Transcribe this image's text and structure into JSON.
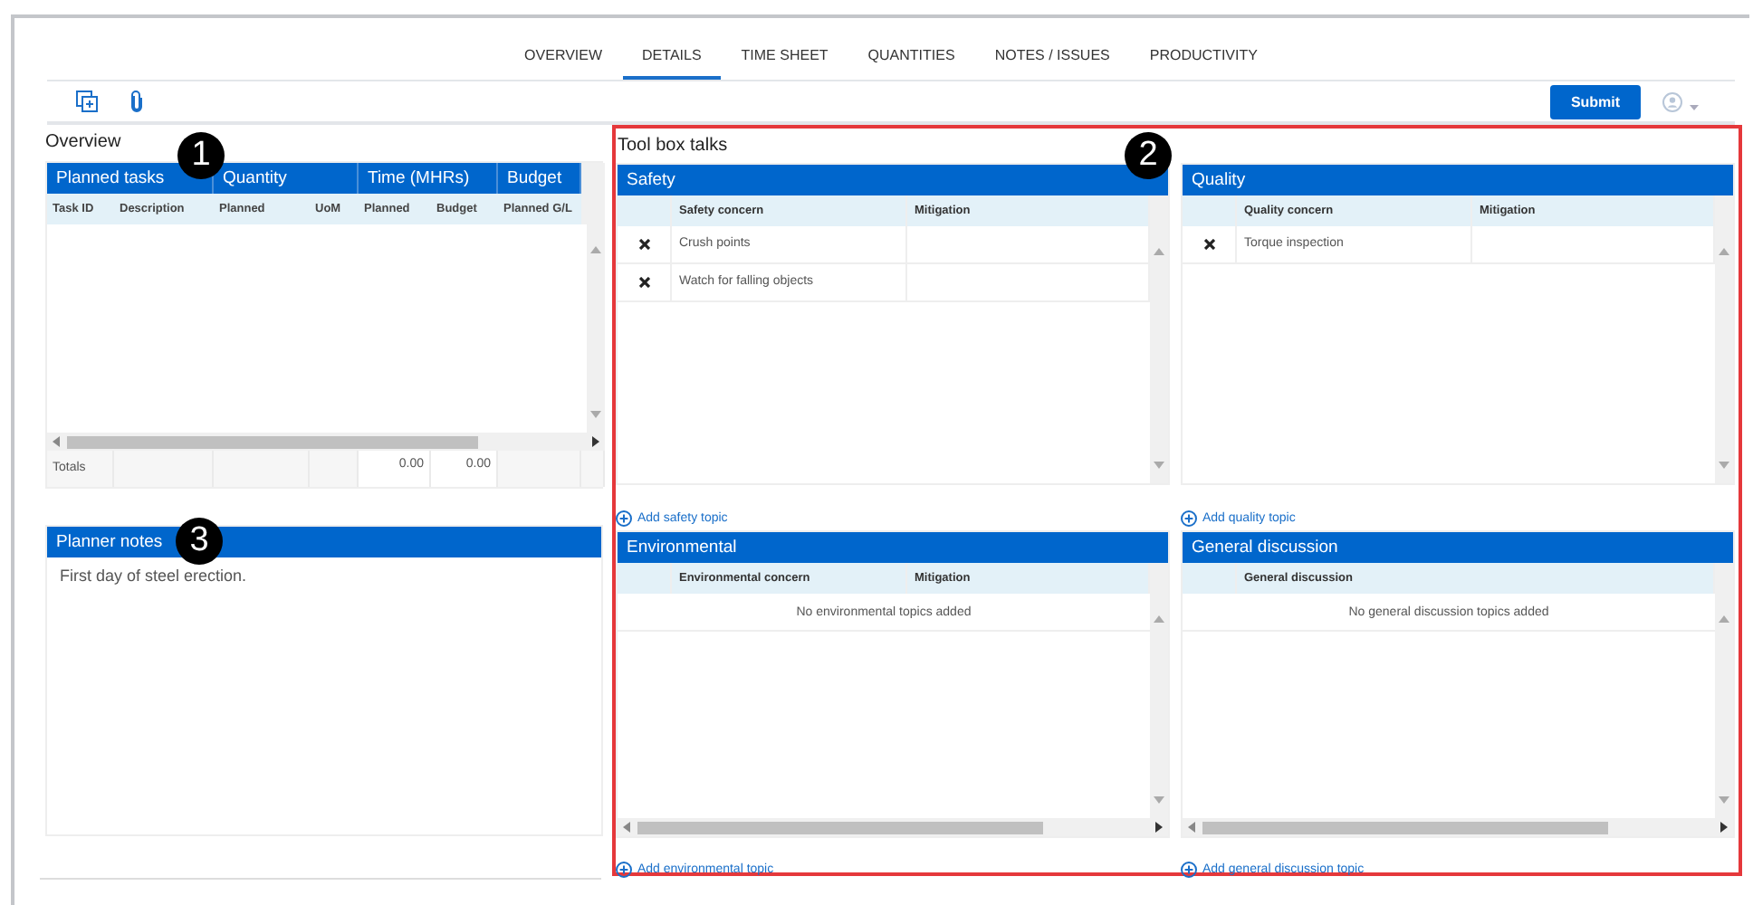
{
  "tabs": [
    {
      "label": "OVERVIEW",
      "selected": false
    },
    {
      "label": "DETAILS",
      "selected": true
    },
    {
      "label": "TIME SHEET",
      "selected": false
    },
    {
      "label": "QUANTITIES",
      "selected": false
    },
    {
      "label": "NOTES / ISSUES",
      "selected": false
    },
    {
      "label": "PRODUCTIVITY",
      "selected": false
    }
  ],
  "toolbar": {
    "submit_button": "Submit"
  },
  "overview": {
    "title": "Overview",
    "group_headers": [
      "Planned tasks",
      "Quantity",
      "Time (MHRs)",
      "Budget"
    ],
    "columns": [
      "Task ID",
      "Description",
      "Planned",
      "UoM",
      "Planned",
      "Budget",
      "Planned G/L"
    ],
    "totals_label": "Totals",
    "totals_values": [
      "0.00",
      "0.00"
    ]
  },
  "planner_notes": {
    "title": "Planner notes",
    "text": "First day of steel erection."
  },
  "toolbox": {
    "title": "Tool box talks",
    "panels": [
      {
        "title": "Safety",
        "columns": [
          "Safety concern",
          "Mitigation"
        ],
        "rows": [
          "Crush points",
          "Watch for falling objects"
        ],
        "horizontal_scrollbar": false,
        "add_link": "Add safety topic"
      },
      {
        "title": "Quality",
        "columns": [
          "Quality concern",
          "Mitigation"
        ],
        "rows": [
          "Torque inspection"
        ],
        "horizontal_scrollbar": false,
        "add_link": "Add quality topic"
      },
      {
        "title": "Environmental",
        "columns": [
          "Environmental concern",
          "Mitigation"
        ],
        "empty_text": "No environmental topics added",
        "horizontal_scrollbar": true,
        "add_link": "Add environmental topic"
      },
      {
        "title": "General discussion",
        "columns": [
          "General discussion"
        ],
        "empty_text": "No general discussion topics added",
        "horizontal_scrollbar": true,
        "add_link": "Add general discussion topic"
      }
    ]
  },
  "callouts": [
    {
      "label": "1"
    },
    {
      "label": "2"
    },
    {
      "label": "3"
    }
  ]
}
